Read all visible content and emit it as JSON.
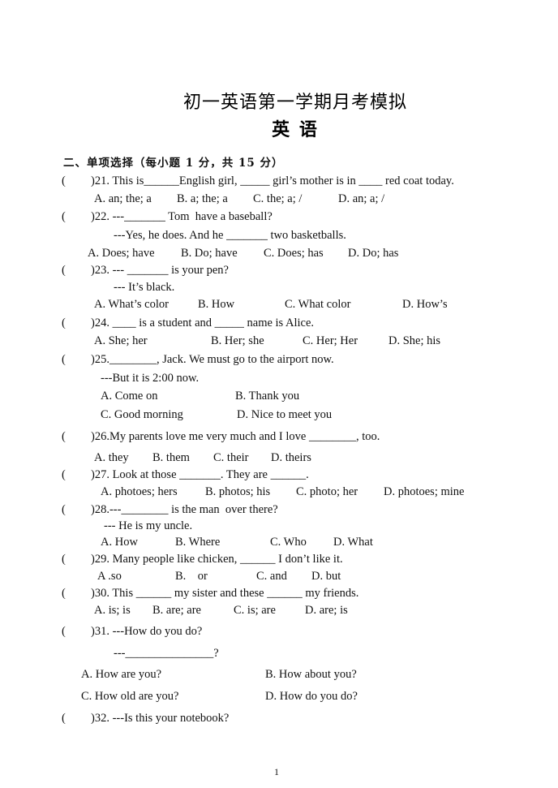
{
  "title": "初一英语第一学期月考模拟",
  "subtitle": "英  语",
  "section_heading": "二、单项选择（每小题 1 分，共 15 分）",
  "answer_paren": "(",
  "questions": [
    {
      "num": "21",
      "stem": ")21. This is______English girl, _____ girl’s mother is in ____ red coat today.",
      "options": [
        "A. an; the; a",
        "B. a; the; a",
        "C. the; a; /",
        "D. an; a; /"
      ]
    },
    {
      "num": "22",
      "stem": ")22. ---_______ Tom  have a baseball?",
      "reply": "---Yes, he does. And he _______ two basketballs.",
      "options": [
        "A. Does; have",
        "B. Do; have",
        "C. Does; has",
        "D. Do; has"
      ]
    },
    {
      "num": "23",
      "stem": ")23. --- _______ is your pen?",
      "reply": "--- It’s black.",
      "options": [
        "A. What’s color",
        "B. How",
        "C. What color",
        "D. How’s"
      ]
    },
    {
      "num": "24",
      "stem": ")24. ____ is a student and _____ name is Alice.",
      "options": [
        "A. She; her",
        "B. Her; she",
        "C. Her; Her",
        "D. She; his"
      ]
    },
    {
      "num": "25",
      "stem": ")25.________, Jack. We must go to the airport now.",
      "reply": "---But it is 2:00 now.",
      "options": [
        "A. Come on",
        "B. Thank you",
        "C. Good morning",
        "D. Nice to meet you"
      ]
    },
    {
      "num": "26",
      "stem": ")26.My parents love me very much and I love ________, too.",
      "options": [
        "A. they",
        "B. them",
        "C. their",
        "D. theirs"
      ]
    },
    {
      "num": "27",
      "stem": ")27. Look at those _______. They are ______.",
      "options": [
        "A. photoes; hers",
        "B. photos; his",
        "C. photo; her",
        "D. photoes; mine"
      ]
    },
    {
      "num": "28",
      "stem": ")28.---________ is the man  over there?",
      "reply": "--- He is my uncle.",
      "options": [
        "A. How",
        "B. Where",
        "C. Who",
        "D. What"
      ]
    },
    {
      "num": "29",
      "stem": ")29. Many people like chicken, ______ I don’t like it.",
      "options": [
        "A .so",
        "B.    or",
        "C. and",
        "D. but"
      ]
    },
    {
      "num": "30",
      "stem": ")30. This ______ my sister and these ______ my friends.",
      "options": [
        "A. is; is",
        "B. are; are",
        "C. is; are",
        "D. are; is"
      ]
    },
    {
      "num": "31",
      "stem": ")31. ---How do you do?",
      "reply": "---_______________?",
      "options": [
        "A. How are you?",
        "B. How about you?",
        "C. How old are you?",
        "D. How do you do?"
      ]
    },
    {
      "num": "32",
      "stem": ")32. ---Is this your notebook?"
    }
  ],
  "page_number": "1"
}
